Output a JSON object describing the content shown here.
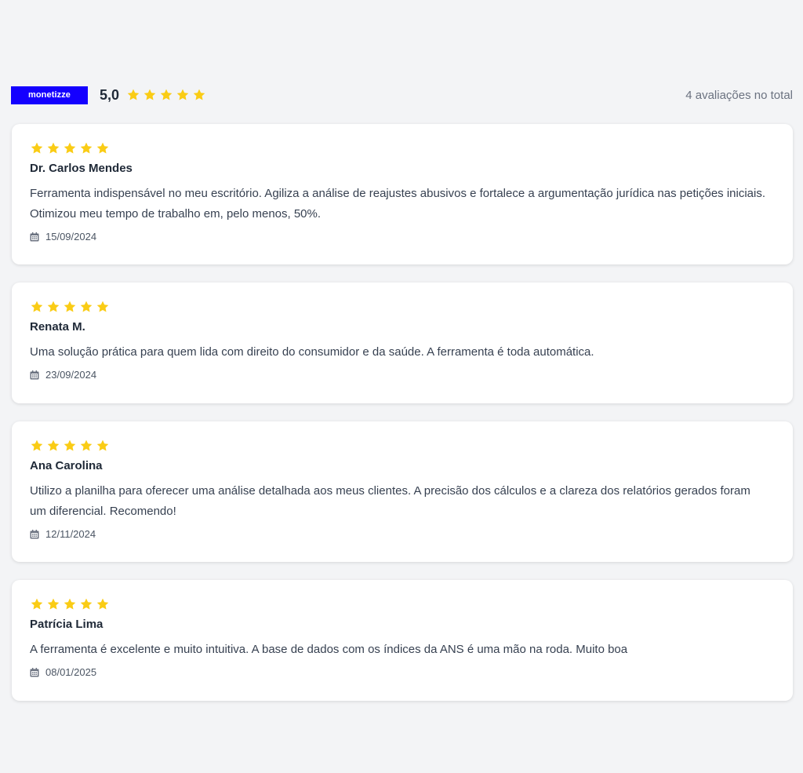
{
  "header": {
    "brand": "monetizze",
    "rating": "5,0",
    "rating_stars": 5,
    "total": "4 avaliações no total"
  },
  "colors": {
    "brand_bg": "#1400ff",
    "star": "#facc15",
    "page_bg": "#f3f4f6"
  },
  "icons": {
    "star": "star-icon",
    "date": "calendar-icon"
  },
  "reviews": [
    {
      "stars": 5,
      "name": "Dr. Carlos Mendes",
      "text": "Ferramenta indispensável no meu escritório. Agiliza a análise de reajustes abusivos e fortalece a argumentação jurídica nas petições iniciais. Otimizou meu tempo de trabalho em, pelo menos, 50%.",
      "date": "15/09/2024"
    },
    {
      "stars": 5,
      "name": "Renata M.",
      "text": "Uma solução prática para quem lida com direito do consumidor e da saúde. A ferramenta é toda automática.",
      "date": "23/09/2024"
    },
    {
      "stars": 5,
      "name": "Ana Carolina",
      "text": "Utilizo a planilha para oferecer uma análise detalhada aos meus clientes. A precisão dos cálculos e a clareza dos relatórios gerados foram um diferencial. Recomendo!",
      "date": "12/11/2024"
    },
    {
      "stars": 5,
      "name": "Patrícia Lima",
      "text": "A ferramenta é excelente e muito intuitiva. A base de dados com os índices da ANS é uma mão na roda. Muito boa",
      "date": "08/01/2025"
    }
  ]
}
